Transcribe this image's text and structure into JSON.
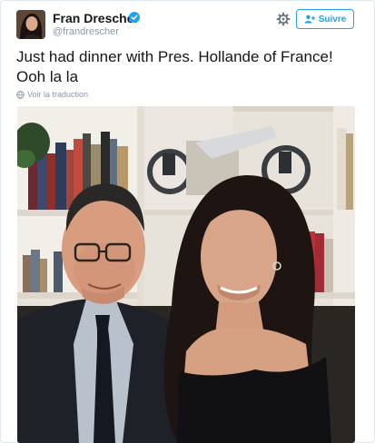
{
  "tweet": {
    "author_name": "Fran Drescher",
    "author_handle": "@frandrescher",
    "follow_label": "Suivre",
    "text": "Just had dinner with Pres. Hollande of France! Ooh la la",
    "translate_label": "Voir la traduction"
  },
  "icons": {
    "verified": "verified-badge-icon",
    "settings": "gear-icon",
    "follow": "add-person-icon",
    "translate": "globe-icon"
  },
  "colors": {
    "accent": "#1da1f2",
    "secondary_text": "#8899a6",
    "primary_text": "#14171a"
  }
}
